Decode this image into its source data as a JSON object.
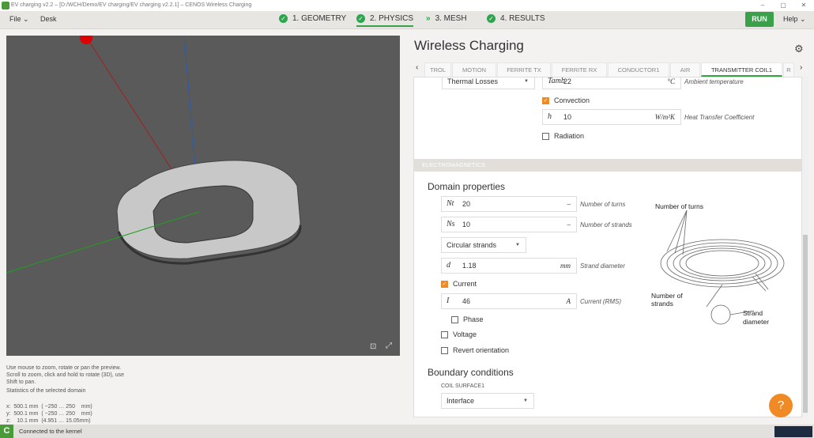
{
  "window": {
    "title": "EV charging v2.2 – [D:/WCH/Demo/EV charging/EV charging v2.2.1] – CENOS Wireless Charging",
    "controls": [
      "–",
      "▢",
      "✕"
    ]
  },
  "menu": {
    "file": "File ⌄",
    "desk": "Desk",
    "run": "RUN",
    "help": "Help ⌄"
  },
  "steps": [
    {
      "label": "1. GEOMETRY",
      "done": true
    },
    {
      "label": "2. PHYSICS",
      "done": true,
      "active": true
    },
    {
      "label": "3. MESH",
      "done": false
    },
    {
      "label": "4. RESULTS",
      "done": true
    }
  ],
  "viewport": {
    "help": [
      "Use mouse to zoom, rotate or pan the preview.",
      "Scroll to zoom, click and hold to rotate (3D), use",
      "Shift to pan."
    ],
    "stats_title": "Statistics of the selected domain",
    "stats": [
      "x:  500.1 mm  ( −250 … 250    mm)",
      "y:  500.1 mm  ( −250 … 250    mm)",
      "z:    10.1 mm  (4.951 … 15.05mm)"
    ]
  },
  "status": {
    "text": "Connected to the kernel"
  },
  "right": {
    "title": "Wireless Charging",
    "tabs": [
      "TROL",
      "MOTION",
      "FERRITE TX",
      "FERRITE RX",
      "CONDUCTOR1",
      "AIR",
      "TRANSMITTER COIL1",
      "R"
    ],
    "thermal": {
      "select": "Thermal Losses",
      "tamb_sym": "Tamb",
      "tamb": "22",
      "tamb_unit": "°C",
      "tamb_desc": "Ambient temperature",
      "convection": "Convection",
      "h_sym": "h",
      "h": "10",
      "h_unit": "W/m²K",
      "h_desc": "Heat Transfer Coefficient",
      "radiation": "Radiation"
    },
    "em_header": "ELECTROMAGNETICS",
    "domain_title": "Domain properties",
    "nt_sym": "Nt",
    "nt": "20",
    "nt_unit": "–",
    "nt_desc": "Number of turns",
    "ns_sym": "Ns",
    "ns": "10",
    "ns_unit": "–",
    "ns_desc": "Number of strands",
    "strand_type": "Circular strands",
    "d_sym": "d",
    "d": "1.18",
    "d_unit": "mm",
    "d_desc": "Strand diameter",
    "current_cb": "Current",
    "i_sym": "I",
    "i": "46",
    "i_unit": "A",
    "i_desc": "Current (RMS)",
    "phase": "Phase",
    "voltage": "Voltage",
    "revert": "Revert orientation",
    "boundary_title": "Boundary conditions",
    "surface": "COIL SURFACE1",
    "interface": "Interface",
    "diagram": {
      "turns": "Number of turns",
      "strands1": "Number of",
      "strands2": "strands",
      "diam1": "Strand",
      "diam2": "diameter"
    }
  },
  "colors": {
    "accent": "#3aa04a",
    "orange": "#f08a24"
  }
}
